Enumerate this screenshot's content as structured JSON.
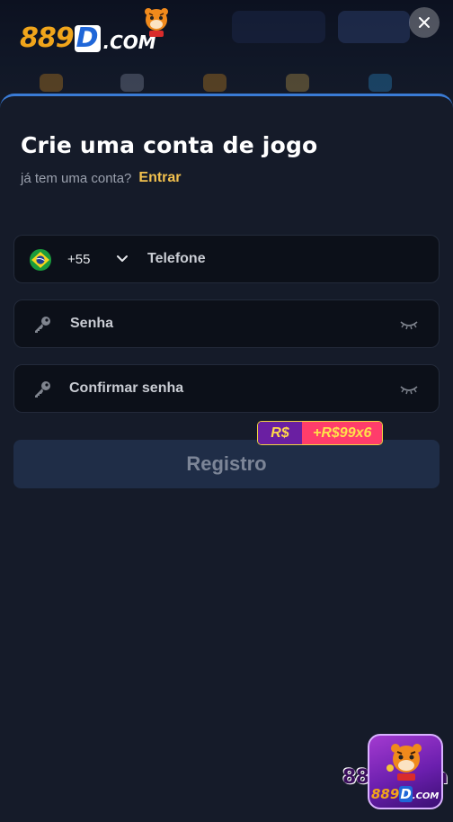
{
  "header": {
    "logo_number": "889",
    "logo_d": "D",
    "logo_suffix": ".COM",
    "close_icon": "close-icon"
  },
  "form": {
    "title": "Crie uma conta de jogo",
    "subtitle": "já tem uma conta?",
    "login_link": "Entrar",
    "phone": {
      "flag": "brazil-flag-icon",
      "country_code": "+55",
      "placeholder": "Telefone"
    },
    "password": {
      "placeholder": "Senha",
      "icon": "key-icon",
      "toggle_icon": "eye-closed-icon"
    },
    "confirm_password": {
      "placeholder": "Confirmar senha",
      "icon": "key-icon",
      "toggle_icon": "eye-closed-icon"
    },
    "register_button": "Registro",
    "bonus": {
      "currency": "R$",
      "amount": "+R$99x6"
    }
  },
  "app_badge": {
    "logo_number": "889",
    "logo_d": "D",
    "logo_suffix": ".COM",
    "watermark": "889d.com"
  },
  "colors": {
    "accent": "#3a7bd5",
    "link": "#f2c14e",
    "background": "#151b29",
    "field_background": "#0c1019",
    "button_disabled": "#1f2d47"
  }
}
